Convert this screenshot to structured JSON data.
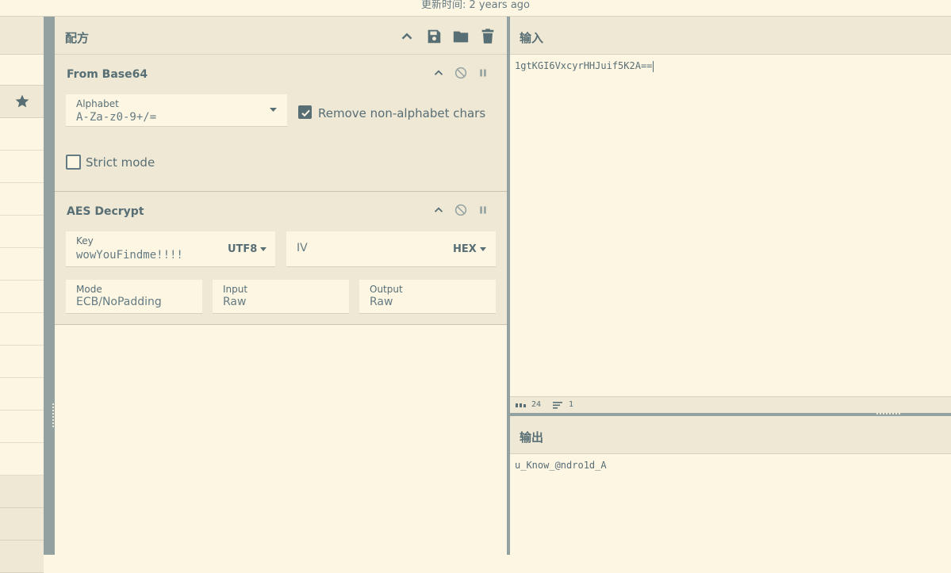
{
  "topbar": {
    "updated": "更新时间: 2 years ago"
  },
  "recipe": {
    "title": "配方",
    "ops": [
      {
        "name": "From Base64",
        "alphabet_label": "Alphabet",
        "alphabet_value": "A-Za-z0-9+/=",
        "remove_nonalpha_label": "Remove non-alphabet chars",
        "remove_nonalpha_checked": true,
        "strict_label": "Strict mode",
        "strict_checked": false
      },
      {
        "name": "AES Decrypt",
        "key_label": "Key",
        "key_value": "wowYouFindme!!!!",
        "key_encoding": "UTF8",
        "iv_placeholder": "IV",
        "iv_encoding": "HEX",
        "mode_label": "Mode",
        "mode_value": "ECB/NoPadding",
        "input_label": "Input",
        "input_value": "Raw",
        "output_label": "Output",
        "output_value": "Raw"
      }
    ]
  },
  "input": {
    "title": "输入",
    "text": "1gtKGI6VxcyrHHJuif5K2A==",
    "status_chars_icon": "abc-icon",
    "status_chars": "24",
    "status_lines_icon": "lines-icon",
    "status_lines": "1"
  },
  "output": {
    "title": "输出",
    "text": "u_Know_@ndro1d_A"
  },
  "colors": {
    "background": "#fdf6e3",
    "panel": "#eee8d5",
    "text": "#586e75",
    "gutter": "#93a1a1"
  }
}
